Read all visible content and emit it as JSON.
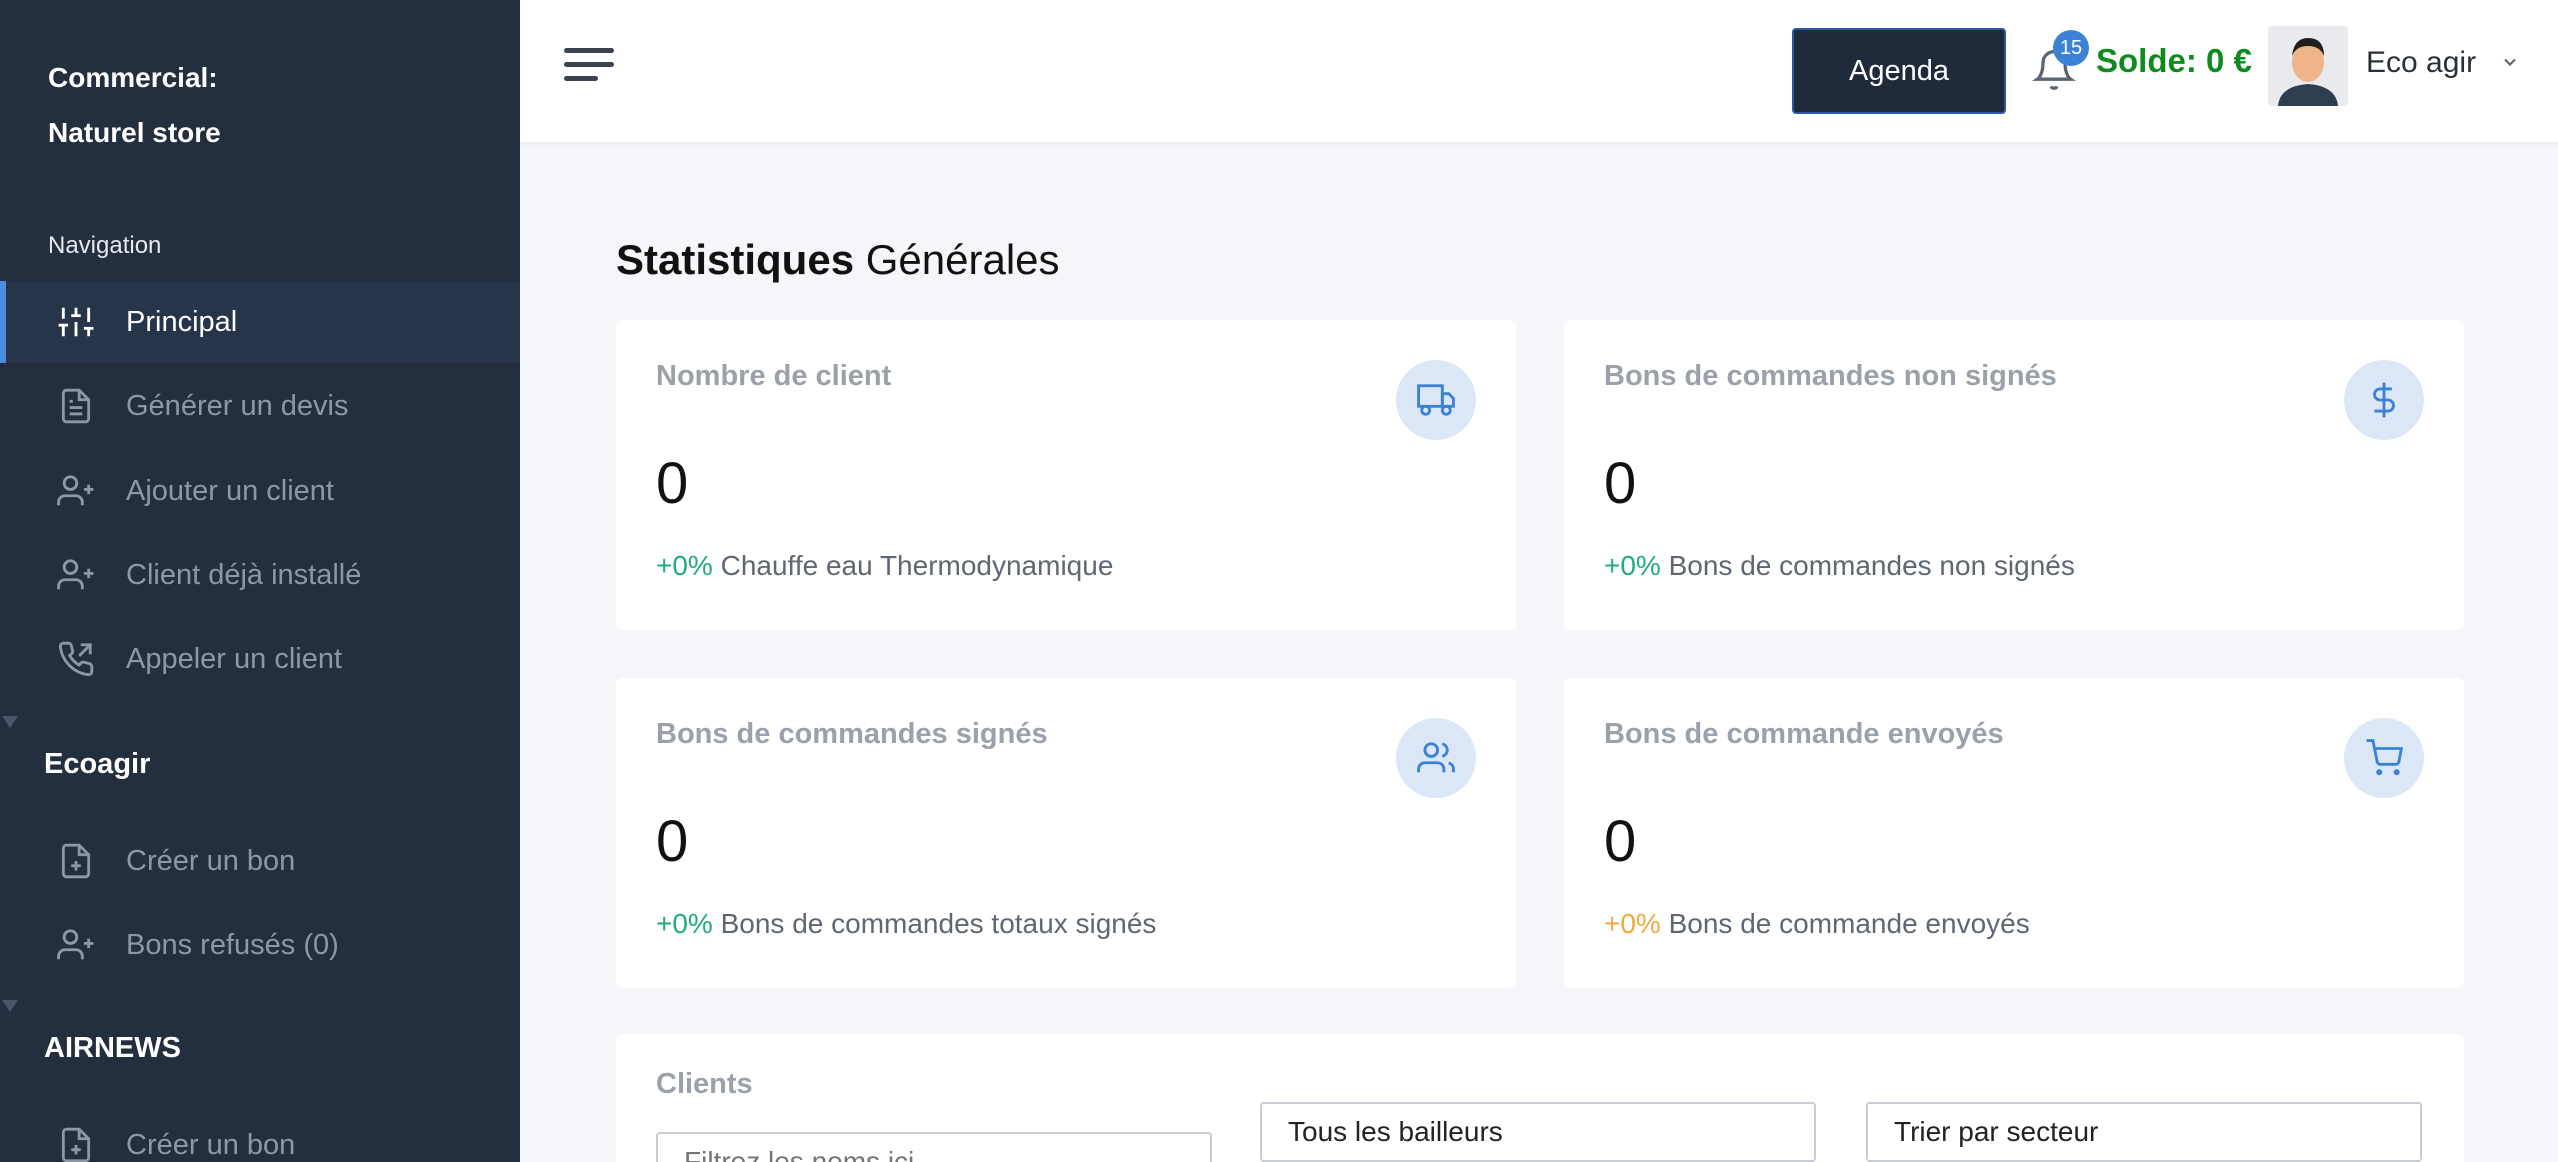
{
  "sidebar": {
    "brand_line1": "Commercial:",
    "brand_line2": "Naturel store",
    "nav_heading": "Navigation",
    "items": [
      {
        "label": "Principal",
        "icon": "sliders-icon",
        "active": true
      },
      {
        "label": "Générer un devis",
        "icon": "document-icon"
      },
      {
        "label": "Ajouter un client",
        "icon": "user-plus-icon"
      },
      {
        "label": "Client déjà installé",
        "icon": "user-plus-icon"
      },
      {
        "label": "Appeler un client",
        "icon": "phone-icon"
      }
    ],
    "sections": [
      {
        "title": "Ecoagir",
        "items": [
          {
            "label": "Créer un bon",
            "icon": "file-plus-icon"
          },
          {
            "label": "Bons refusés (0)",
            "icon": "user-plus-icon"
          }
        ]
      },
      {
        "title": "AIRNEWS",
        "items": [
          {
            "label": "Créer un bon",
            "icon": "file-plus-icon"
          }
        ]
      }
    ]
  },
  "topbar": {
    "agenda_label": "Agenda",
    "notifications_count": "15",
    "solde": "Solde: 0 €",
    "user_name": "Eco agir"
  },
  "main": {
    "title_bold": "Statistiques",
    "title_rest": " Générales",
    "cards": [
      {
        "title": "Nombre de client",
        "value": "0",
        "pct": "+0%",
        "footer": " Chauffe eau Thermodynamique",
        "icon": "truck-icon"
      },
      {
        "title": "Bons de commandes non signés",
        "value": "0",
        "pct": "+0%",
        "footer": " Bons de commandes non signés",
        "icon": "dollar-icon"
      },
      {
        "title": "Bons de commandes signés",
        "value": "0",
        "pct": "+0%",
        "footer": " Bons de commandes totaux signés",
        "icon": "users-icon"
      },
      {
        "title": "Bons de commande envoyés",
        "value": "0",
        "pct": "+0%",
        "footer": " Bons de commande envoyés",
        "icon": "cart-icon"
      }
    ],
    "clients": {
      "title": "Clients",
      "filter_placeholder": "Filtrez les noms ici",
      "bailleurs": "Tous les bailleurs",
      "secteur": "Trier par secteur"
    }
  },
  "colors": {
    "sidebar_bg": "#232f3f",
    "accent": "#3b82d6",
    "solde": "#0f8a1e",
    "pct_positive": "#1fae7a",
    "pct_warn": "#f2a93b"
  }
}
